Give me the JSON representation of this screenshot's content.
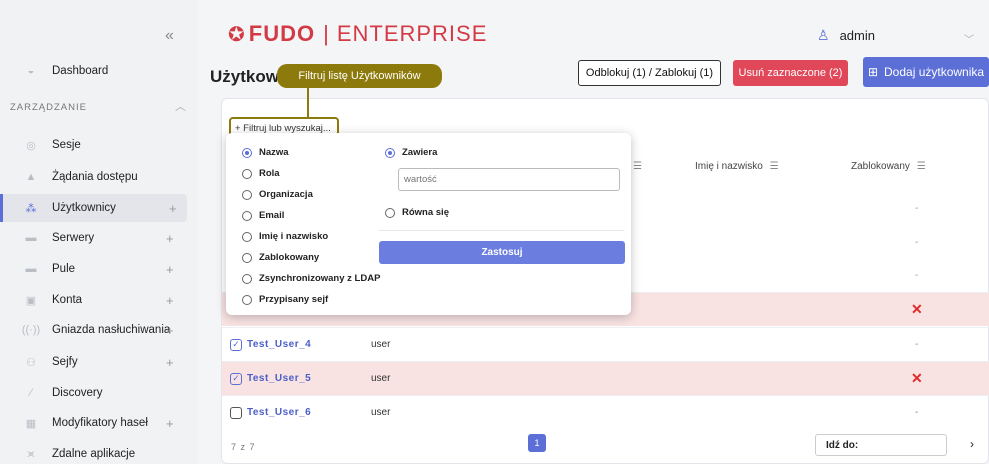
{
  "sidebar": {
    "collapse_icon": "«",
    "section_label": "ZARZĄDZANIE",
    "items": [
      {
        "label": "Dashboard",
        "icon": "dashboard-icon"
      },
      {
        "label": "Sesje",
        "icon": "sessions-icon"
      },
      {
        "label": "Żądania dostępu",
        "icon": "access-request-icon"
      },
      {
        "label": "Użytkownicy",
        "icon": "users-icon",
        "plus": "+"
      },
      {
        "label": "Serwery",
        "icon": "server-icon",
        "plus": "+"
      },
      {
        "label": "Pule",
        "icon": "pool-icon",
        "plus": "+"
      },
      {
        "label": "Konta",
        "icon": "account-icon",
        "plus": "+"
      },
      {
        "label": "Gniazda nasłuchiwania",
        "icon": "listener-icon",
        "plus": "+"
      },
      {
        "label": "Sejfy",
        "icon": "safe-icon",
        "plus": "+"
      },
      {
        "label": "Discovery",
        "icon": "discovery-icon"
      },
      {
        "label": "Modyfikatory haseł",
        "icon": "password-modifier-icon",
        "plus": "+"
      },
      {
        "label": "Zdalne aplikacje",
        "icon": "remote-app-icon"
      }
    ]
  },
  "header": {
    "logo_fudo": "FUDO",
    "logo_sep": "|",
    "logo_enterprise": "ENTERPRISE",
    "user": "admin"
  },
  "page": {
    "title": "Użytkow",
    "btn_unlock": "Odblokuj (1) / Zablokuj (1)",
    "btn_delete": "Usuń zaznaczone (2)",
    "btn_add": "Dodaj użytkownika"
  },
  "tooltip": "Filtruj listę Użytkowników",
  "filter": {
    "button_label": "+ Filtruj lub wyszukaj...",
    "fields": [
      "Nazwa",
      "Rola",
      "Organizacja",
      "Email",
      "Imię i nazwisko",
      "Zablokowany",
      "Zsynchronizowany z LDAP",
      "Przypisany sejf"
    ],
    "selected_field": "Nazwa",
    "op_contains": "Zawiera",
    "op_equals": "Równa się",
    "value_placeholder": "wartość",
    "apply": "Zastosuj"
  },
  "table": {
    "headers": {
      "fullname": "Imię i nazwisko",
      "blocked": "Zablokowany"
    },
    "rows": [
      {
        "name": "Test_User_4",
        "role": "user",
        "blocked": "-"
      },
      {
        "name": "Test_User_5",
        "role": "user",
        "blocked": "✕"
      },
      {
        "name": "Test_User_6",
        "role": "user",
        "blocked": "-"
      }
    ],
    "dash": "-",
    "blocked_x": "✕"
  },
  "footer": {
    "count": "7 z 7",
    "page": "1",
    "goto_label": "Idź do:",
    "goto_arrow": "›"
  },
  "colors": {
    "accent": "#5b6fd6",
    "danger": "#e0485a",
    "tooltip": "#8c7a0c",
    "brand": "#d43a45"
  }
}
